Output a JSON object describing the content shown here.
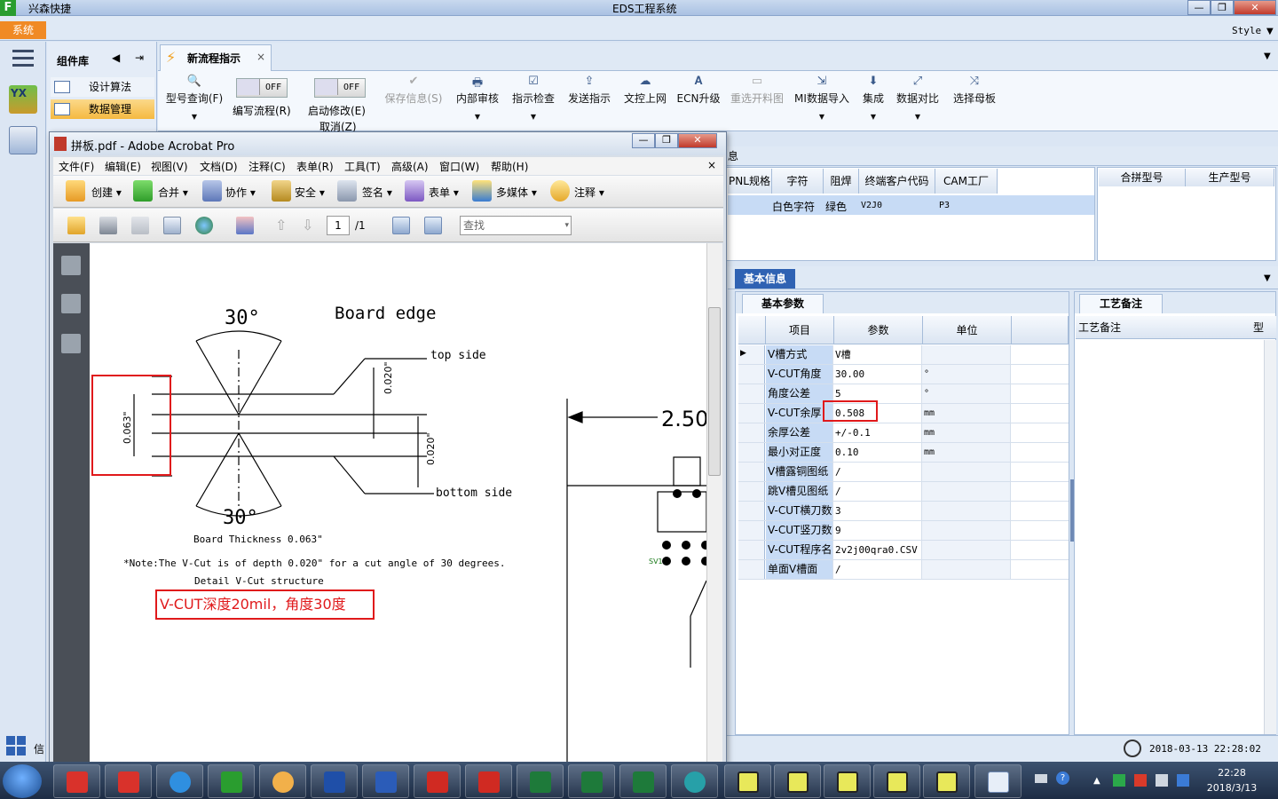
{
  "app": {
    "name": "兴森快捷",
    "window_title": "EDS工程系统",
    "system_btn": "系统",
    "style_label": "Style"
  },
  "components": {
    "title": "组件库",
    "items": [
      "设计算法",
      "数据管理"
    ]
  },
  "tabs": {
    "active": "新流程指示",
    "close": "×"
  },
  "toolbar": {
    "model_query": "型号查询(F)",
    "edit_flow": "编写流程(R)",
    "edit_toggle": "OFF",
    "start_modify": "启动修改(E)",
    "start_toggle": "OFF",
    "cancel": "取消(Z)",
    "save_info": "保存信息(S)",
    "internal_review": "内部审核",
    "instr_check": "指示检查",
    "send_instr": "发送指示",
    "doc_upload": "文控上网",
    "ecn_upgrade": "ECN升级",
    "reselect_material": "重选开料图",
    "mi_import": "MI数据导入",
    "integrate": "集成",
    "data_compare": "数据对比",
    "select_master": "选择母板"
  },
  "grid_top": {
    "section_label": "息",
    "headers": [
      "PNL规格",
      "字符",
      "阻焊",
      "终端客户代码",
      "CAM工厂"
    ],
    "row": [
      "",
      "白色字符",
      "绿色",
      "V2J0",
      "P3"
    ],
    "right_headers": [
      "合拼型号",
      "生产型号"
    ]
  },
  "basic_info": {
    "tab": "基本信息",
    "param_tab": "基本参数",
    "headers": [
      "项目",
      "参数",
      "单位"
    ],
    "rows": [
      {
        "item": "V槽方式",
        "param": "V槽",
        "unit": ""
      },
      {
        "item": "V-CUT角度",
        "param": "30.00",
        "unit": "°"
      },
      {
        "item": "角度公差",
        "param": "5",
        "unit": "°"
      },
      {
        "item": "V-CUT余厚",
        "param": "0.508",
        "unit": "mm"
      },
      {
        "item": "余厚公差",
        "param": "+/-0.1",
        "unit": "mm"
      },
      {
        "item": "最小对正度",
        "param": "0.10",
        "unit": "mm"
      },
      {
        "item": "V槽露铜图纸",
        "param": "/",
        "unit": ""
      },
      {
        "item": "跳V槽见图纸",
        "param": "/",
        "unit": ""
      },
      {
        "item": "V-CUT横刀数",
        "param": "3",
        "unit": ""
      },
      {
        "item": "V-CUT竖刀数",
        "param": "9",
        "unit": ""
      },
      {
        "item": "V-CUT程序名",
        "param": "2v2j00qra0.CSV",
        "unit": ""
      },
      {
        "item": "单面V槽面",
        "param": "/",
        "unit": ""
      }
    ],
    "craft_tab": "工艺备注",
    "craft_header": "工艺备注",
    "craft_header2": "型"
  },
  "status": {
    "time": "2018-03-13 22:28:02"
  },
  "acrobat": {
    "title": "拼板.pdf - Adobe Acrobat Pro",
    "menu": [
      "文件(F)",
      "编辑(E)",
      "视图(V)",
      "文档(D)",
      "注释(C)",
      "表单(R)",
      "工具(T)",
      "高级(A)",
      "窗口(W)",
      "帮助(H)"
    ],
    "tools": [
      "创建",
      "合并",
      "协作",
      "安全",
      "签名",
      "表单",
      "多媒体",
      "注释"
    ],
    "page_current": "1",
    "page_total": "/1",
    "find_placeholder": "查找",
    "close": "×"
  },
  "pdf": {
    "angle_top": "30°",
    "angle_bottom": "30°",
    "board_edge": "Board edge",
    "top_side": "top side",
    "bottom_side": "bottom side",
    "depth1": "0.020\"",
    "depth2": "0.020\"",
    "thickness_dim": "0.063\"",
    "board_thickness": "Board Thickness 0.063\"",
    "note": "*Note:The V-Cut is of depth 0.020\" for a cut angle of 30 degrees.",
    "detail": "Detail V-Cut structure",
    "annotation": "V-CUT深度20mil，角度30度",
    "dim_250": "2.50",
    "sv1": "SV1"
  },
  "taskbar": {
    "time": "22:28",
    "date": "2018/3/13"
  },
  "colors": {
    "accent_blue": "#2f62b3",
    "highlight_red": "#e0191b",
    "system_orange": "#f08a24",
    "row_blue": "#c7dbf5"
  }
}
